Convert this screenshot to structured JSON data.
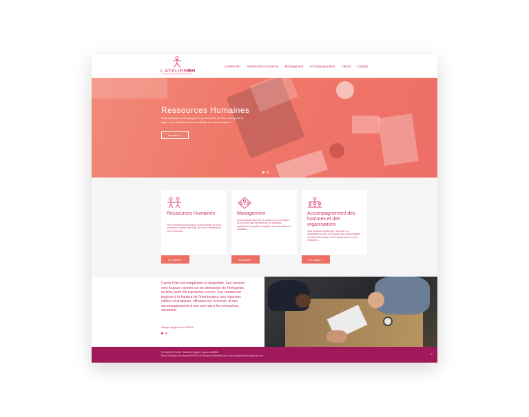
{
  "header": {
    "logo_text_a": "L'ATELIER",
    "logo_text_b": "RH",
    "nav": [
      "L'Atelier RH",
      "Ressources Humaines",
      "Management",
      "Accompagnement",
      "Clients",
      "Contact"
    ]
  },
  "hero": {
    "title": "Ressources Humaines",
    "subtitle": "Vous souhaitez accompagner la performance de votre entreprise et aligner vos outils RH avec la stratégie de votre entreprise...",
    "button": "En savoir +",
    "slides": 2,
    "active_slide": 1
  },
  "services": [
    {
      "icon": "people-icon",
      "title": "Ressources Humaines",
      "text": "Vous souhaitez accompagner la performance de votre entreprise et aligner vos outils RH avec la stratégie de votre entreprise...",
      "button": "En savoir +"
    },
    {
      "icon": "management-icon",
      "title": "Management",
      "text": "Vous souhaitez apporter un soutien à vos managers de proximité pour appréhender les situations quotidiennes de gestion d'équipes dans de meilleures conditions...",
      "button": "En savoir +"
    },
    {
      "icon": "team-icon",
      "title": "Accompagnement des hommes et des organisations",
      "text": "Vous souhaitez développer l'esprit de vos collaborateurs et de vos équipes afin d'accompagner les différentes phases de développement de votre entreprise...",
      "button": "En savoir +"
    }
  ],
  "testimonial": {
    "quote": "Carole Pilet est compétente et disponible. Ses conseils sont toujours centrés sur les demandes de l'entreprise, qu'elles aient été exprimées ou non. Son contact est toujours à la hauteur de l'interlocuteur, ses réponses ciblées et pratiques, efficaces sur le terrain, et son accompagnement et son suivi dans les entreprises, constants.",
    "author": "Délégué Régional du FAFSEA",
    "dots": 2,
    "active_dot": 0
  },
  "footer": {
    "line1": "© L'Atelier RH 2016 - Mentions légales - Agence AM&RG",
    "line2": "Merci à l'équipe de l'espace BOMIZE de Bordeaux Mériadeck pour son accueil lors des prises de vue",
    "totop": "^"
  },
  "colors": {
    "brand": "#c9316a",
    "accent": "#ed6f64",
    "footer": "#a0195a"
  }
}
